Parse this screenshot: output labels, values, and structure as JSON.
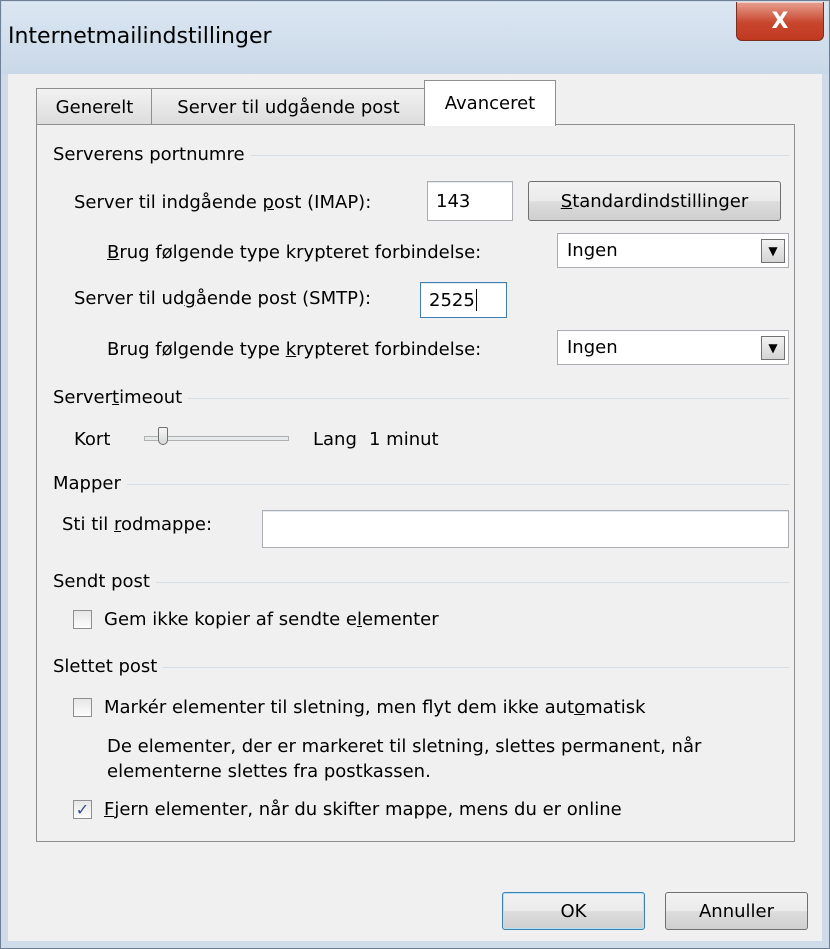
{
  "window": {
    "title": "Internetmailindstillinger",
    "close_label": "X"
  },
  "tabs": [
    {
      "label": "Generelt",
      "active": false
    },
    {
      "label": "Server til udgående post",
      "active": false
    },
    {
      "label": "Avanceret",
      "active": true
    }
  ],
  "ports": {
    "group_label": "Serverens portnumre",
    "imap_label_before": "Server til indgående ",
    "imap_label_accel": "p",
    "imap_label_after": "ost (IMAP):",
    "imap_value": "143",
    "defaults_button_accel": "S",
    "defaults_button_rest": "tandardindstillinger",
    "enc1_label_accel": "B",
    "enc1_label_rest": "rug følgende type krypteret forbindelse:",
    "enc1_value": "Ingen",
    "smtp_label_before": "Server til ud",
    "smtp_label_accel": "g",
    "smtp_label_after": "ående post (SMTP):",
    "smtp_value": "2525",
    "enc2_label_before": "Brug følgende type ",
    "enc2_label_accel": "k",
    "enc2_label_after": "rypteret forbindelse:",
    "enc2_value": "Ingen"
  },
  "timeout": {
    "group_label_before": "Server",
    "group_label_accel": "t",
    "group_label_after": "imeout",
    "short_label": "Kort",
    "long_label": "Lang",
    "value_text": "1 minut",
    "slider_level": 0
  },
  "folders": {
    "group_label": "Mapper",
    "root_label_before": "Sti til ",
    "root_label_accel": "r",
    "root_label_after": "odmappe:",
    "root_value": ""
  },
  "sent": {
    "group_label": "Sendt post",
    "checkbox_label_before": "Gem ikke kopier af sendte e",
    "checkbox_label_accel": "l",
    "checkbox_label_after": "ementer",
    "checked": false
  },
  "deleted": {
    "group_label": "Slettet post",
    "mark_label_before": "Markér elementer til sletning, men flyt dem ikke aut",
    "mark_label_accel": "o",
    "mark_label_after": "matisk",
    "mark_checked": false,
    "info_line1": "De elementer, der er markeret til sletning, slettes permanent, når",
    "info_line2": "elementerne slettes fra postkassen.",
    "remove_label_accel": "F",
    "remove_label_rest": "jern elementer, når du skifter mappe, mens du er online",
    "remove_checked": true,
    "check_glyph": "✓"
  },
  "buttons": {
    "ok": "OK",
    "cancel": "Annuller"
  },
  "icons": {
    "dropdown": "dropdown-arrow-icon",
    "close": "close-icon"
  }
}
